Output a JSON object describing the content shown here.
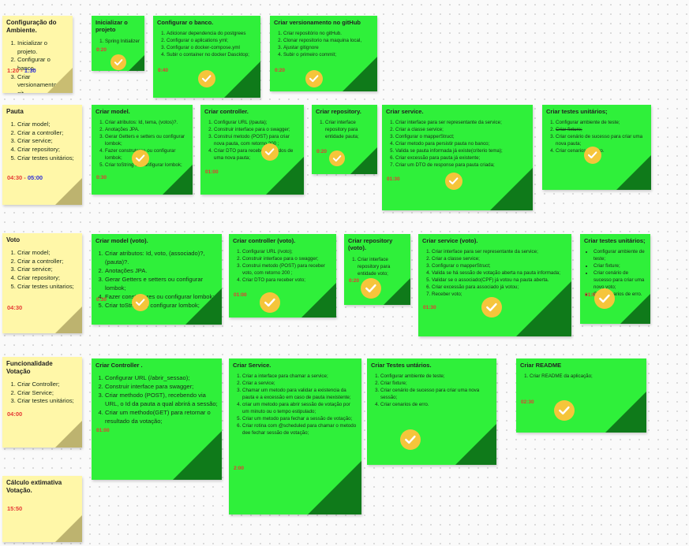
{
  "colors": {
    "yellow_note": "#fff7a8",
    "green_note": "#2ff03a",
    "time_start": "#e53935",
    "time_end": "#2d2dd6",
    "check": "#f5c53b"
  },
  "sections": [
    {
      "title": "Configuração do Ambiente.",
      "items": [
        "Inicializar o projeto.",
        "Configurar o banco.",
        "Criar versionamento no git."
      ],
      "time_start": "1:20 - ",
      "time_end": "1:30"
    },
    {
      "title": "Pauta",
      "items": [
        "Criar model;",
        "Criar a controller;",
        "Criar service;",
        "Criar repository;",
        "Criar testes unitários;"
      ],
      "time_start": "04:30 - ",
      "time_end": "05:00"
    },
    {
      "title": "Voto",
      "items": [
        "Criar model;",
        "Criar a controller;",
        "Criar service;",
        "Criar repository;",
        "Criar testes unitarios;"
      ],
      "time_start": "04:30",
      "time_end": ""
    },
    {
      "title": "Funcionalidade Votação",
      "items": [
        "Criar Controller;",
        "Criar Service;",
        "Criar testes unitários;"
      ],
      "time_start": "04:00",
      "time_end": ""
    },
    {
      "title": "Cálculo extimativa Votação.",
      "items": [],
      "time_start": "15:50",
      "time_end": ""
    }
  ],
  "tasks": [
    {
      "title": "Inicializar o projeto",
      "items": [
        "Spring Initializer"
      ],
      "time": "0:20",
      "check": true
    },
    {
      "title": "Configurar o banco.",
      "items": [
        "Adicionar dependencia do postgrees",
        "Configurar o aplications yml;",
        "Configurar o docker-compose.yml",
        "Subir o container no docker Dascktop;"
      ],
      "time": "0:40",
      "check": true
    },
    {
      "title": "Criar versionamento no gitHub",
      "items": [
        "Criar repositório no gitHub.",
        "Clonar repositorio na maquina local,",
        "Ajustar gitignore",
        "Subir o primeiro commit;"
      ],
      "time": "0:20",
      "check": true
    },
    {
      "title": "Criar model.",
      "items": [
        "Criar atributos: Id, tema, (votos)?.",
        "Anotações JPA.",
        "Gerar Getters e setters ou configurar lombok;",
        "Fazer construtores ou configurar lombok;",
        "Criar toString ou configurar lombok;"
      ],
      "time": "0:30",
      "check": true
    },
    {
      "title": "Criar controller.",
      "items": [
        "Configurar URL (/pauta);",
        "Construir interface para o swagger;",
        "Construi metodo (POST) para criar nova pauta, com retorno 200 ;",
        "Criar DTO para receber os dados de uma nova pauta;"
      ],
      "time": "01:00",
      "check": true
    },
    {
      "title": "Criar repository.",
      "items": [
        "Criar interface repository para entidade pauta;"
      ],
      "time": "0:20",
      "check": true
    },
    {
      "title": "Criar service.",
      "items": [
        "Criar interface para ser representante da service;",
        "Criar a classe service;",
        "Configurar o mapperStruct;",
        "Criar metodo para persistir pauta no banco;",
        "Valida se pauta informada já existe(criterio tema);",
        "Criar excessão para pauta já existente;",
        "Criar um DTO de response para pauta criada;"
      ],
      "time": "01:30",
      "check": true
    },
    {
      "title": "Criar testes unitários;",
      "items": [
        "Configurar ambiente de teste;",
        "Criar fixture;",
        "Criar cenário de sucesso para criar uma nova pauta;",
        "Criar cenarios de erro."
      ],
      "time": "",
      "check": true
    },
    {
      "title": "Criar model (voto).",
      "items": [
        "Criar atributos: Id, voto, (associado)?, (pauta)?.",
        "Anotações JPA.",
        "Gerar Getters e setters ou configurar lombok;",
        "Fazer construtores ou configurar lombok;",
        "Criar toString ou configurar lombok;"
      ],
      "time": "0:30",
      "check": true
    },
    {
      "title": "Criar controller (voto).",
      "items": [
        "Configurar URL (/voto);",
        "Construir interface para o swagger;",
        "Construi metodo (POST) para receber voto, com retorno 200 ;",
        "Criar DTO para receber voto;"
      ],
      "time": "01:00",
      "check": true
    },
    {
      "title": "Criar repository (voto).",
      "items": [
        "Criar interface repository para entidade voto;"
      ],
      "time": "0:20",
      "check": true
    },
    {
      "title": "Criar service (voto).",
      "items": [
        "Criar interface para ser representante da service;",
        "Criar a classe service;",
        "Configurar o mapperStruct;",
        "Valida se há sessão de votação aberta na pauta informada;",
        "Validar se o associado(CPF) já votou na pauta aberta.",
        "Criar excessão para associado já votou;",
        "Receber voto;"
      ],
      "time": "01:30",
      "check": true
    },
    {
      "title": "Criar testes unitários;",
      "items": [
        "Configurar ambiente de teste;",
        "Criar fixture;",
        "Criar cenário de sucesso para criar uma novo voto;",
        "Criar cenarios de erro."
      ],
      "time": "01:00",
      "check": true
    },
    {
      "title": "Criar Controller .",
      "items": [
        "Configurar URL (/abrir_sessao);",
        "Construir interface para swagger;",
        "Criar methodo (POST), recebendo via URL, o Id da pauta a qual abrirá a sessão;",
        "Criar um methodo(GET) para retornar o resultado da votação;"
      ],
      "time": "01:00",
      "check": false
    },
    {
      "title": "Criar Service.",
      "items": [
        "Criar a interface para chamar a service;",
        "Criar a service;",
        "Chamar um metodo para validar a existencia da pauta e a excessão em caso de pauta inexistente;",
        "criar um metodo para abrir sessão de votação por um minuto ou o tempo estipulado;",
        "Criar um metodo para fechar a sessão de votação;",
        "Criar rotina com @scheduled para chamar o metodo dee fechar sessão de votação;"
      ],
      "time": "2:00",
      "check": false
    },
    {
      "title": "Criar Testes untários.",
      "items": [
        "Configurar ambiente de teste;",
        "Criar fixture;",
        "Criar cenário de sucesso para criar uma nova sessão;",
        "Criar cenarios de erro."
      ],
      "time": "",
      "check": true
    },
    {
      "title": "Criar README",
      "items": [
        "Criar README da aplicação;"
      ],
      "time": "02:30",
      "check": true
    }
  ]
}
